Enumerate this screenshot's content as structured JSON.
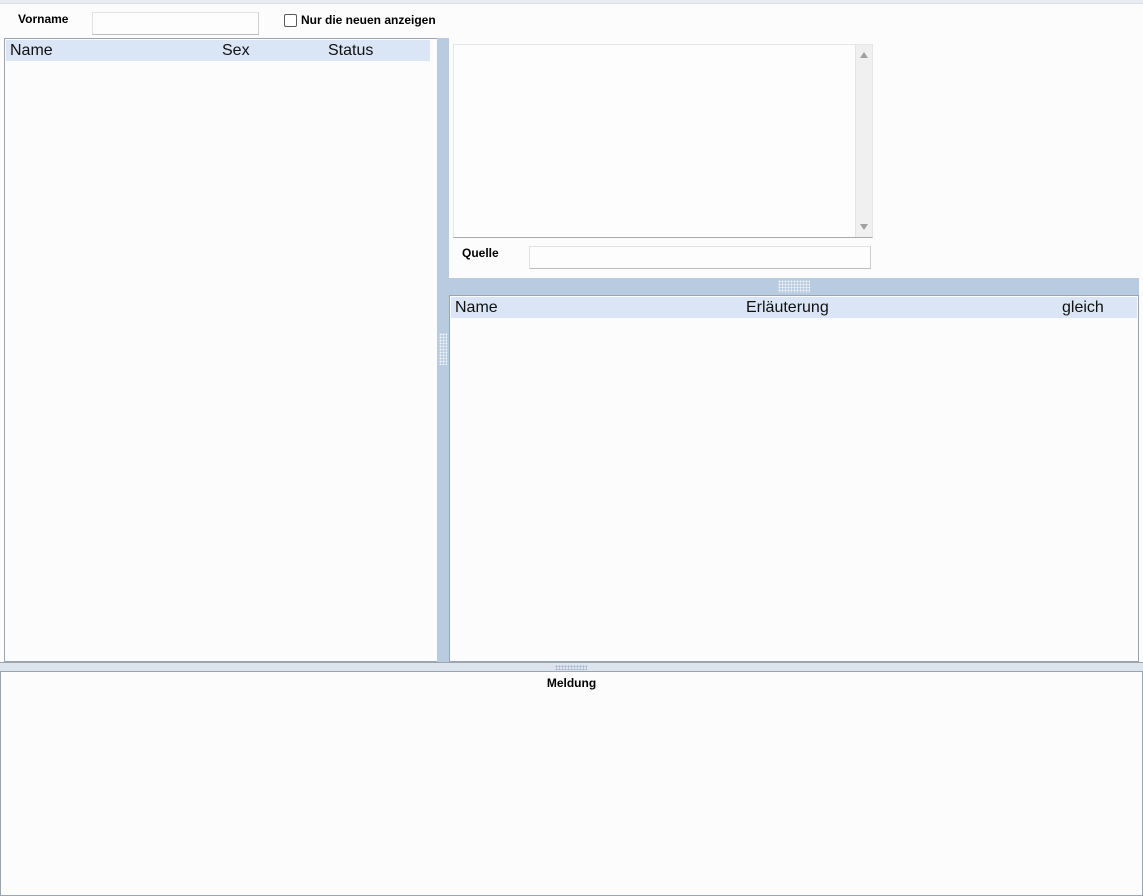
{
  "filter": {
    "vorname_label": "Vorname",
    "vorname_value": "",
    "new_only_label": "Nur die neuen anzeigen",
    "new_only_checked": false
  },
  "left_table": {
    "columns": [
      "Name",
      "Sex",
      "Status"
    ],
    "rows": []
  },
  "detail": {
    "text_value": "",
    "quelle_label": "Quelle",
    "quelle_value": ""
  },
  "right_table": {
    "columns": [
      "Name",
      "Erläuterung",
      "gleich"
    ],
    "rows": []
  },
  "message": {
    "title": "Meldung",
    "text": ""
  },
  "colors": {
    "header_bg": "#dae5f5",
    "splitter": "#b8cbe0",
    "border": "#9aa5b3"
  }
}
